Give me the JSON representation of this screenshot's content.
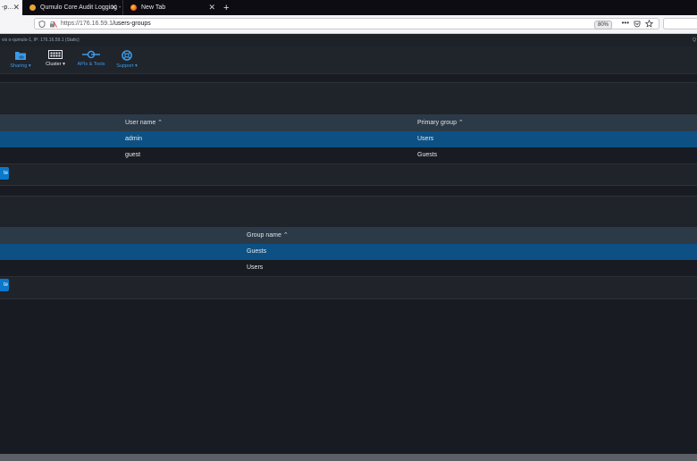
{
  "browser": {
    "tabs": [
      {
        "label": "-p…",
        "active": true
      },
      {
        "label": "Qumulo Core Audit Logging - ",
        "active": false
      },
      {
        "label": "New Tab",
        "active": false
      }
    ],
    "new_tab_symbol": "+",
    "url_host": "https://176.16.59.1",
    "url_path": "/users-groups",
    "zoom": "80%"
  },
  "app": {
    "info_text": "vis o-qumulo-1, IP: 176.16.59.1 (Static)",
    "right_info": "Q",
    "nav": [
      {
        "label": "Sharing ▾",
        "icon": "folder-cloud-icon"
      },
      {
        "label": "Cluster ▾",
        "icon": "server-icon"
      },
      {
        "label": "APIs & Tools",
        "icon": "api-plug-icon"
      },
      {
        "label": "Support ▾",
        "icon": "lifebuoy-icon"
      }
    ]
  },
  "users_table": {
    "headers": [
      "User name ⌃",
      "Primary group ⌃"
    ],
    "rows": [
      {
        "name": "admin",
        "group": "Users",
        "selected": true
      },
      {
        "name": "guest",
        "group": "Guests",
        "selected": false
      }
    ],
    "button_label": "te"
  },
  "groups_table": {
    "headers": [
      "Group name ⌃"
    ],
    "rows": [
      {
        "name": "Guests",
        "selected": true
      },
      {
        "name": "Users",
        "selected": false
      }
    ],
    "button_label": "te"
  },
  "colors": {
    "accent": "#3b9ae8",
    "selected_row": "#0d5184",
    "button": "#0b78c9"
  }
}
